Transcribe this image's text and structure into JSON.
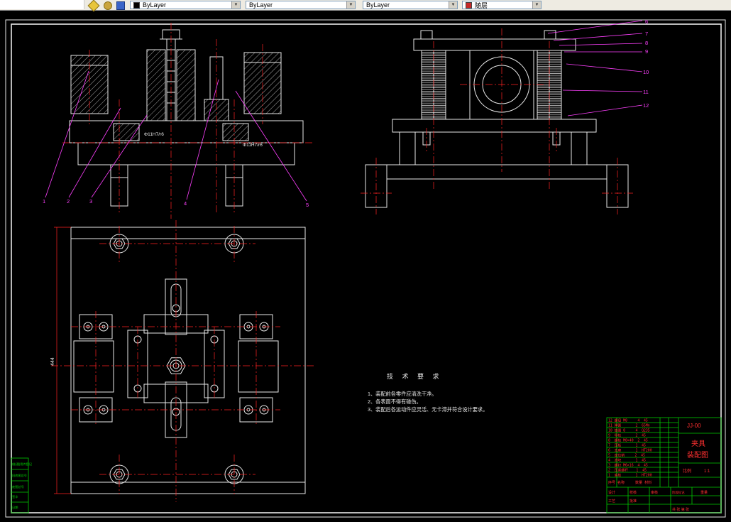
{
  "toolbar": {
    "combos": [
      {
        "value": "ByLayer"
      },
      {
        "value": "ByLayer"
      },
      {
        "value": "ByLayer"
      },
      {
        "value": "随层"
      }
    ]
  },
  "leaders": {
    "front": [
      "1",
      "2",
      "3",
      "4",
      "5"
    ],
    "side": [
      "6",
      "7",
      "8",
      "9",
      "10",
      "11",
      "12"
    ]
  },
  "dims": {
    "fit_left": "Φ11H7/r6",
    "fit_right": "Φ11H7/r6",
    "plan_height": "444"
  },
  "tech_req": {
    "title": "技 术 要 求",
    "items": [
      "1、装配前各零件应清洗干净。",
      "2、各表面不得有碰伤。",
      "3、装配后各运动件应灵活、无卡滞并符合设计要求。"
    ]
  },
  "title_block": {
    "parts_header": "序号 名称     数量 材料",
    "parts_rows": [
      "12 螺母 M8     4  45",
      "11 弹簧       2  65Mn",
      "10 垫圈 8     4  Q235",
      "9  导柱       2  45",
      "8  螺栓 M8×40  2  45",
      "7  压板       1  45",
      "6  支座       1  HT200",
      "5  定位销     2  45",
      "4  滑块       1  45",
      "3  螺钉 M6×16  4  45",
      "2  压紧螺杆    1  45",
      "1  底板       1  HT200"
    ],
    "drawing_no": "JJ-00",
    "name_line1": "夹具",
    "name_line2": "装配图",
    "fields": {
      "design": "设计",
      "check": "校核",
      "review": "审核",
      "process": "工艺",
      "approve": "批准",
      "stage": "阶段标记",
      "weight": "重量",
      "scale": "比例",
      "scale_value": "1:1",
      "sheet": "共 张 第 张"
    }
  },
  "frame_table": {
    "labels": [
      "借(通)用件登记",
      "旧底图总号",
      "底图总号",
      "签字",
      "日期"
    ]
  }
}
